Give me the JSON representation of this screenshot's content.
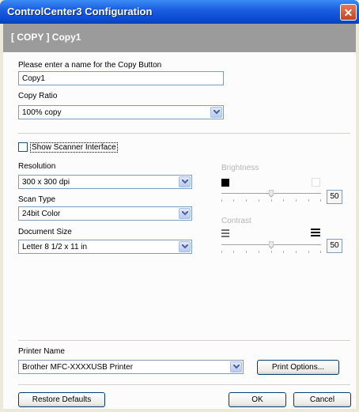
{
  "window": {
    "title": "ControlCenter3 Configuration"
  },
  "header": {
    "text": "[ COPY ]   Copy1"
  },
  "copy": {
    "name_label": "Please enter a name for the Copy Button",
    "name_value": "Copy1",
    "ratio_label": "Copy Ratio",
    "ratio_value": "100% copy"
  },
  "scanner": {
    "show_interface_label": "Show Scanner Interface",
    "show_interface_checked": false
  },
  "resolution": {
    "label": "Resolution",
    "value": "300 x 300 dpi"
  },
  "scan_type": {
    "label": "Scan Type",
    "value": "24bit Color"
  },
  "document_size": {
    "label": "Document Size",
    "value": "Letter 8 1/2 x 11 in"
  },
  "brightness": {
    "label": "Brightness",
    "value": "50"
  },
  "contrast": {
    "label": "Contrast",
    "value": "50"
  },
  "printer": {
    "label": "Printer Name",
    "value": "Brother MFC-XXXXUSB Printer",
    "options_button": "Print Options..."
  },
  "footer": {
    "restore_button": "Restore Defaults",
    "ok_button": "OK",
    "cancel_button": "Cancel"
  }
}
